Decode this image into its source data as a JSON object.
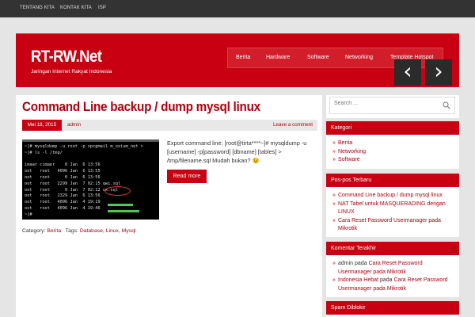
{
  "topbar": {
    "links": [
      "TENTANG KITA",
      "KONTAK KITA",
      "ISP"
    ]
  },
  "header": {
    "site_title": "RT-RW.Net",
    "site_description": "Jaringan Internet Rakyat Indonesia",
    "nav": [
      "Berita",
      "Hardware",
      "Software",
      "Networking",
      "Template Hotspot"
    ],
    "slider_prev": "‹",
    "slider_next": "›"
  },
  "post": {
    "title": "Command Line backup / dump mysql linux",
    "date": "Mei 18, 2015",
    "author": "admin",
    "comment_link": "Leave a comment",
    "excerpt": "Export command line: [root@tirta****~]# mysqldump -u [username] -p[password] [dbname] [tables] > /tmp/filename.sql   Mudah bukan? 😉",
    "read_more": "Read more",
    "category_label": "Category:",
    "category": "Berita",
    "tags_label": "Tags:",
    "tags": [
      "Database",
      "Linux",
      "Mysql"
    ],
    "terminal_lines": [
      "~]# mysqldump -u root -p vpcgmail m_oxium_net >",
      "~]# ls -l /tmp/",
      "",
      "imaar cimaer    0 Jan  6 13:56",
      "oot   root   4096 Jan  6 13:55",
      "oot   root      0 Jan  6 13:56",
      "oot   root   2299 Jan  7 02:15 qwi.sql",
      "oot   root      0 Jan  7 02:12 ux.sql",
      "oot   root   2329 Jan  6 13:56",
      "oot   root   4096 Jan  4 19:19",
      "oot   root   4096 Jan  4 19:46",
      "~]#"
    ]
  },
  "search": {
    "placeholder": "Search ..."
  },
  "widgets": {
    "kategori": {
      "title": "Kategori",
      "items": [
        "Berita",
        "Networking",
        "Software"
      ]
    },
    "pos_terbaru": {
      "title": "Pos-pos Terbaru",
      "items": [
        "Command Line backup / dump mysql linux",
        "NAT Tabel untuk MASQUERADING dengan LINUX",
        "Cara Reset Password Usermanager pada Mikrotik"
      ]
    },
    "komentar": {
      "title": "Komentar Terakhir",
      "items": [
        {
          "author": "admin",
          "on": "pada",
          "post": "Cara Reset Password Usermanager pada Mikrotik"
        },
        {
          "author": "Indonesia Hebat",
          "on": "pada",
          "post": "Cara Reset Password Usermanager pada Mikrotik"
        }
      ]
    },
    "spam": {
      "title": "Spam Diblokir"
    }
  },
  "colors": {
    "brand_red": "#c90012",
    "dark": "#333333"
  }
}
